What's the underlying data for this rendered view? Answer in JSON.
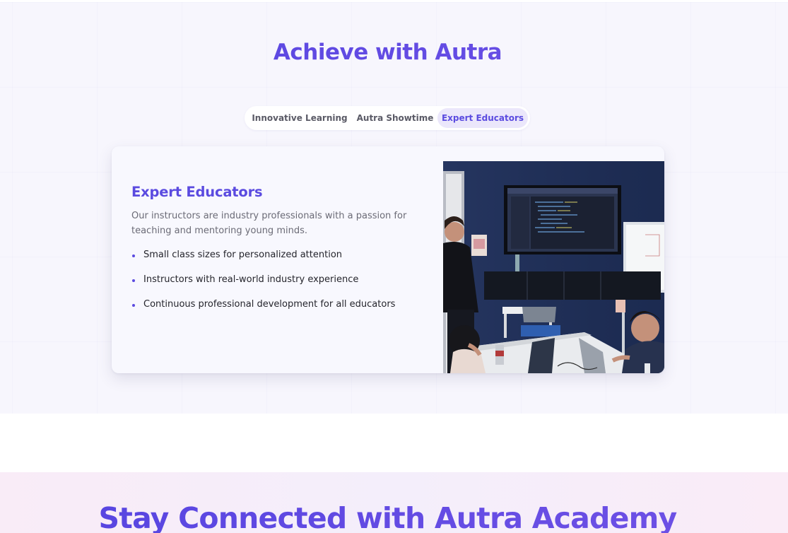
{
  "achieve": {
    "title": "Achieve with Autra",
    "tabs": [
      {
        "label": "Innovative Learning",
        "active": false
      },
      {
        "label": "Autra Showtime",
        "active": false
      },
      {
        "label": "Expert Educators",
        "active": true
      }
    ],
    "panel": {
      "title": "Expert Educators",
      "description": "Our instructors are industry professionals with a passion for teaching and mentoring young minds.",
      "bullets": [
        "Small class sizes for personalized attention",
        "Instructors with real-world industry experience",
        "Continuous professional development for all educators"
      ]
    }
  },
  "connect": {
    "title": "Stay Connected with Autra Academy"
  },
  "colors": {
    "accent": "#5b4be0",
    "active_tab_bg": "#ebe7fb",
    "section_bg": "#f7f6fd"
  }
}
